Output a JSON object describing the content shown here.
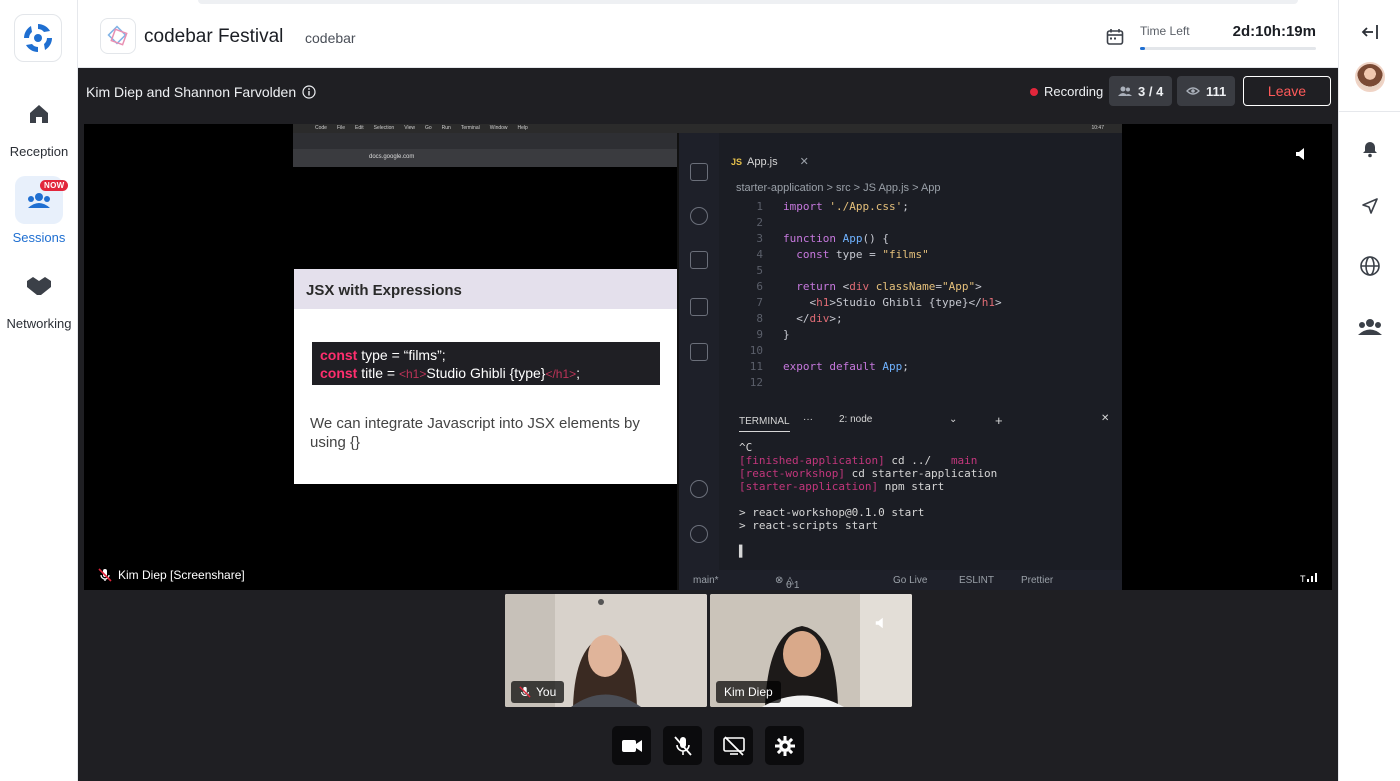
{
  "nav": {
    "items": [
      {
        "label": "Reception",
        "icon": "home-icon"
      },
      {
        "label": "Sessions",
        "icon": "sessions-icon",
        "badge": "NOW"
      },
      {
        "label": "Networking",
        "icon": "handshake-icon"
      }
    ]
  },
  "header": {
    "event_title": "codebar Festival",
    "organizer": "codebar",
    "time_left_label": "Time Left",
    "time_left_value": "2d:10h:19m",
    "time_left_progress": 0.03
  },
  "session": {
    "title": "Kim Diep and Shannon Farvolden",
    "recording_label": "Recording",
    "participants_count": "3 / 4",
    "viewers_count": "111",
    "leave_label": "Leave"
  },
  "screenshare": {
    "label": "Kim Diep [Screenshare]",
    "browser_url": "docs.google.com",
    "slide": {
      "title": "JSX with Expressions",
      "code_line_1_kw": "const",
      "code_line_1": " type = “films”;",
      "code_line_2_kw": "const",
      "code_line_2_a": " title = ",
      "code_line_2_tag_open": "<h1>",
      "code_line_2_b": "Studio Ghibli {type}",
      "code_line_2_tag_close": "</h1>",
      "code_line_2_c": ";",
      "body": "We can integrate Javascript into JSX elements by using {}"
    },
    "editor": {
      "tab": "App.js",
      "breadcrumb": "starter-application > src > JS App.js > App",
      "terminal_tab": "TERMINAL",
      "terminal_select": "2: node",
      "status_branch": "main*",
      "status_errors": "0",
      "status_warnings": "1",
      "status_golive": "Go Live",
      "status_eslint": "ESLINT",
      "status_prettier": "Prettier"
    }
  },
  "participants": [
    {
      "name": "You",
      "muted": true
    },
    {
      "name": "Kim Diep",
      "muted": false
    }
  ],
  "colors": {
    "accent": "#1f6fd1",
    "danger": "#e2263b",
    "stage_bg": "#1f1f23"
  }
}
